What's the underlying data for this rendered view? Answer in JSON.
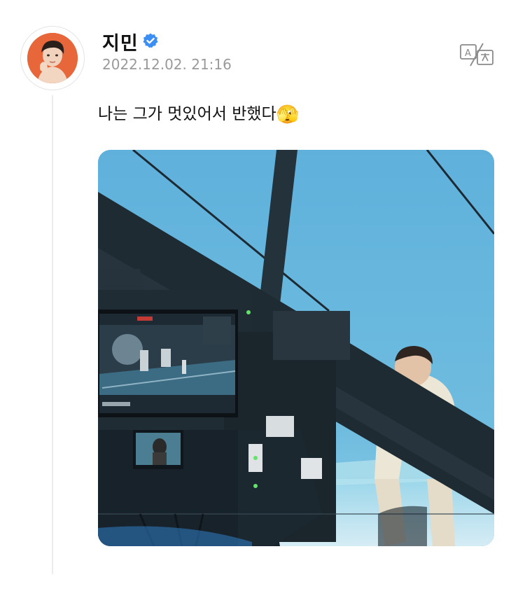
{
  "author": {
    "name": "지민",
    "verified": true,
    "timestamp": "2022.12.02. 21:16"
  },
  "post": {
    "text": "나는 그가 멋있어서 반했다",
    "emoji": "🫣"
  },
  "icons": {
    "verified": "verified-badge-icon",
    "translate": "translate-icon"
  },
  "colors": {
    "verified_blue": "#3b8ef3",
    "avatar_bg": "#e8673a",
    "timestamp_gray": "#9a9a9a",
    "thread_line": "#ececec"
  }
}
